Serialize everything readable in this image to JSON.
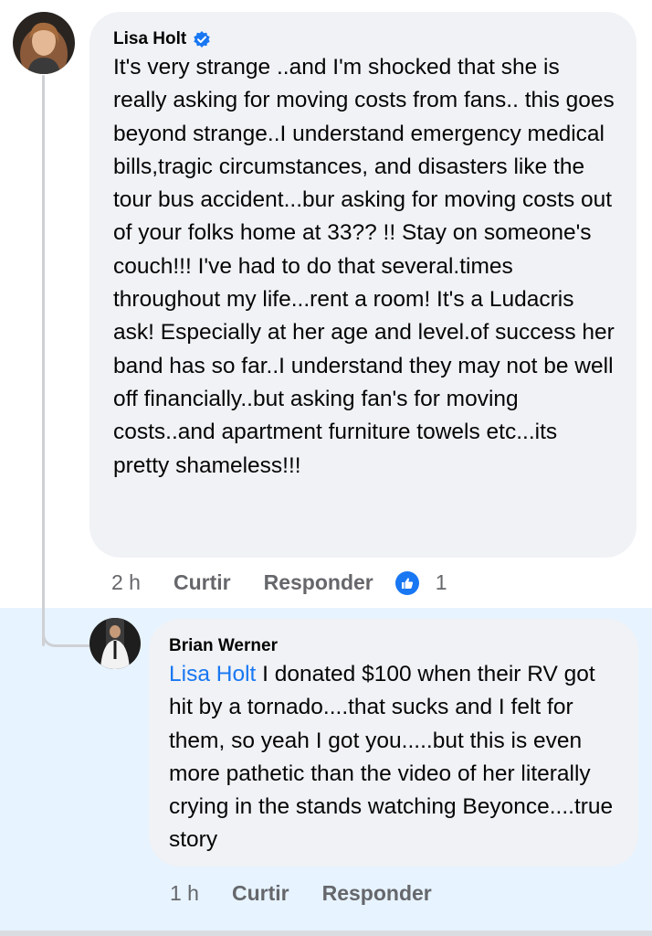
{
  "comment": {
    "author": "Lisa Holt",
    "verified": true,
    "text": "It's very strange ..and I'm shocked that she is really asking for moving costs from fans.. this goes beyond strange..I understand emergency medical bills,tragic circumstances, and disasters like the tour bus accident...bur asking for moving costs out of your folks home at 33?? !! Stay on someone's couch!!! I've had to do that several.times throughout my life...rent a room! It's a Ludacris ask! Especially at her age and level.of  success her band has so far..I understand they may not be well off financially..but asking fan's for moving costs..and apartment furniture towels etc...its pretty shameless!!!",
    "time": "2 h",
    "like_label": "Curtir",
    "reply_label": "Responder",
    "reaction_count": "1"
  },
  "reply": {
    "author": "Brian Werner",
    "mention": "Lisa Holt",
    "text": " I donated $100 when their RV got hit by a tornado....that sucks and I felt for them, so yeah I got you.....but this is even more pathetic than the video of her literally crying in the stands watching Beyonce....true story",
    "time": "1 h",
    "like_label": "Curtir",
    "reply_label": "Responder"
  },
  "colors": {
    "bubble": "#f0f2f5",
    "highlight": "#e7f3ff",
    "accent": "#1877f2",
    "muted": "#65676b"
  },
  "icons": {
    "verified": "verified-badge-icon",
    "reaction": "thumbs-up-icon"
  }
}
